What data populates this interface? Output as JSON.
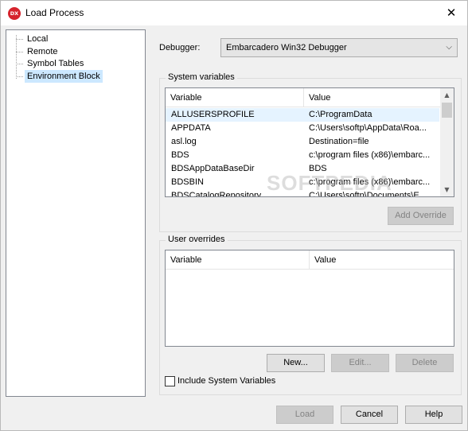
{
  "window": {
    "title": "Load Process",
    "app_icon_text": "DX",
    "close_glyph": "✕"
  },
  "tree": {
    "items": [
      {
        "label": "Local"
      },
      {
        "label": "Remote"
      },
      {
        "label": "Symbol Tables"
      },
      {
        "label": "Environment Block",
        "selected": true
      }
    ]
  },
  "debugger": {
    "label": "Debugger:",
    "value": "Embarcadero Win32 Debugger"
  },
  "system_variables": {
    "title": "System variables",
    "columns": [
      "Variable",
      "Value"
    ],
    "rows": [
      {
        "variable": "ALLUSERSPROFILE",
        "value": "C:\\ProgramData"
      },
      {
        "variable": "APPDATA",
        "value": "C:\\Users\\softp\\AppData\\Roa..."
      },
      {
        "variable": "asl.log",
        "value": "Destination=file"
      },
      {
        "variable": "BDS",
        "value": "c:\\program files (x86)\\embarc..."
      },
      {
        "variable": "BDSAppDataBaseDir",
        "value": "BDS"
      },
      {
        "variable": "BDSBIN",
        "value": "c:\\program files (x86)\\embarc..."
      },
      {
        "variable": "BDSCatalogRepository",
        "value": "C:\\Users\\softp\\Documents\\E..."
      }
    ],
    "add_override_label": "Add Override"
  },
  "user_overrides": {
    "title": "User overrides",
    "columns": [
      "Variable",
      "Value"
    ],
    "new_label": "New...",
    "edit_label": "Edit...",
    "delete_label": "Delete"
  },
  "include_system_variables": {
    "label": "Include System Variables",
    "checked": false
  },
  "footer": {
    "load_label": "Load",
    "cancel_label": "Cancel",
    "help_label": "Help"
  },
  "watermark": "SOFTPEDIA"
}
